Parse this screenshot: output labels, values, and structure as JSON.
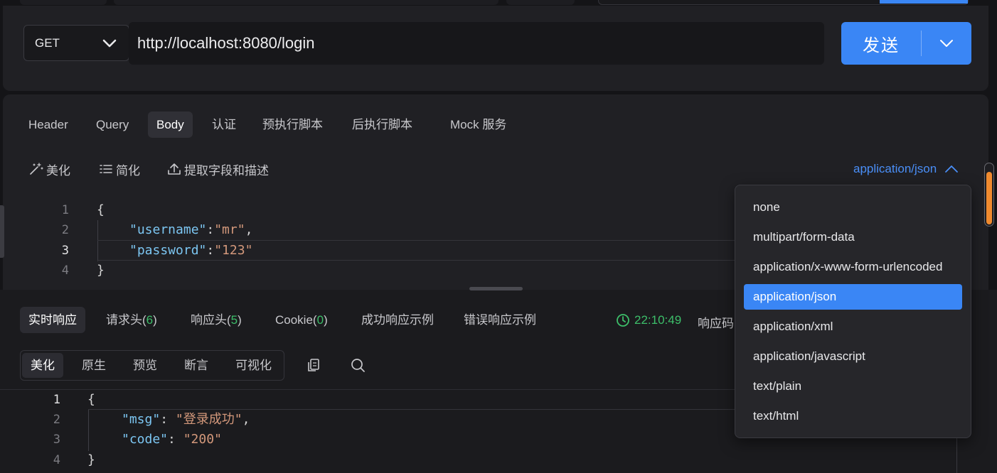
{
  "request": {
    "method": "GET",
    "url": "http://localhost:8080/login",
    "send_label": "发送"
  },
  "param_tabs": [
    {
      "label": "Header",
      "active": false
    },
    {
      "label": "Query",
      "active": false
    },
    {
      "label": "Body",
      "active": true
    },
    {
      "label": "认证",
      "active": false
    },
    {
      "label": "预执行脚本",
      "active": false
    },
    {
      "label": "后执行脚本",
      "active": false
    },
    {
      "label": "Mock 服务",
      "active": false
    }
  ],
  "body_tools": {
    "beautify": "美化",
    "simplify": "简化",
    "extract": "提取字段和描述",
    "content_type": "application/json"
  },
  "request_body": {
    "line_numbers": [
      "1",
      "2",
      "3",
      "4"
    ],
    "open_brace": "{",
    "close_brace": "}",
    "username_key": "\"username\"",
    "username_value": "\"mr\"",
    "password_key": "\"password\"",
    "password_value": "\"123\"",
    "colon": ":",
    "comma": ","
  },
  "content_type_options": [
    {
      "label": "none",
      "selected": false
    },
    {
      "label": "multipart/form-data",
      "selected": false
    },
    {
      "label": "application/x-www-form-urlencoded",
      "selected": false
    },
    {
      "label": "application/json",
      "selected": true
    },
    {
      "label": "application/xml",
      "selected": false
    },
    {
      "label": "application/javascript",
      "selected": false
    },
    {
      "label": "text/plain",
      "selected": false
    },
    {
      "label": "text/html",
      "selected": false
    }
  ],
  "response_tabs": {
    "realtime": "实时响应",
    "req_headers": "请求头(",
    "req_headers_count": "6",
    "resp_headers": "响应头(",
    "resp_headers_count": "5",
    "cookie": "Cookie(",
    "cookie_count": "0",
    "close_paren": ")",
    "success_example": "成功响应示例",
    "error_example": "错误响应示例",
    "time": "22:10:49",
    "resp_code_label": "响应码"
  },
  "view_modes": [
    {
      "label": "美化",
      "active": true
    },
    {
      "label": "原生",
      "active": false
    },
    {
      "label": "预览",
      "active": false
    },
    {
      "label": "断言",
      "active": false
    },
    {
      "label": "可视化",
      "active": false
    }
  ],
  "response_body": {
    "line_numbers": [
      "1",
      "2",
      "3",
      "4"
    ],
    "open_brace": "{",
    "close_brace": "}",
    "msg_key": "\"msg\"",
    "msg_value": "\"登录成功\"",
    "code_key": "\"code\"",
    "code_value": "\"200\"",
    "colon_space": ": ",
    "comma": ","
  },
  "colors": {
    "accent": "#3a86f5",
    "success": "#3dbf6a",
    "json_key": "#7cc6f2",
    "json_string": "#d3987b",
    "scroll_thumb": "#f08a2e"
  }
}
